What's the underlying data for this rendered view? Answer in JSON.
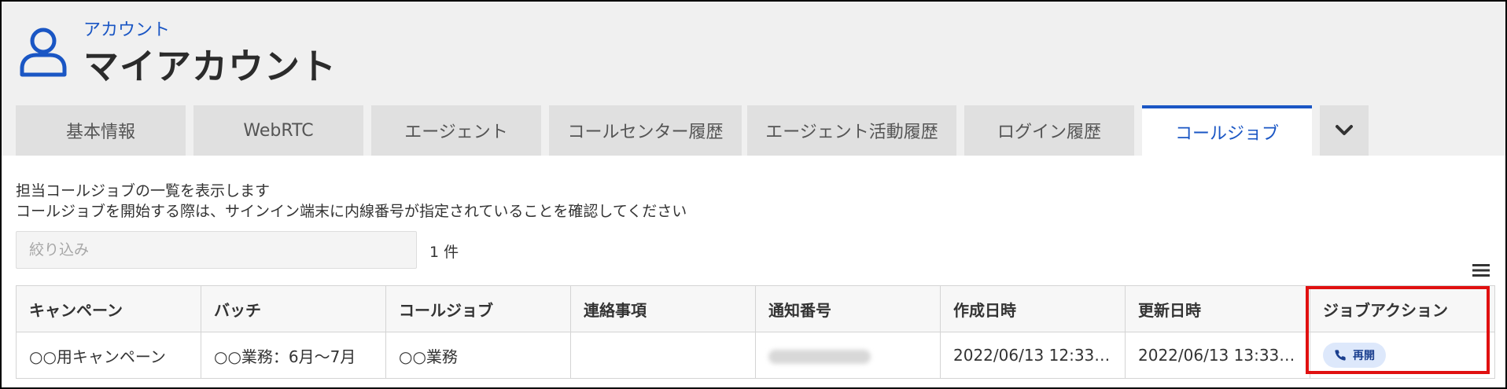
{
  "header": {
    "breadcrumb": "アカウント",
    "title": "マイアカウント"
  },
  "tabs": [
    {
      "label": "基本情報",
      "active": false
    },
    {
      "label": "WebRTC",
      "active": false
    },
    {
      "label": "エージェント",
      "active": false
    },
    {
      "label": "コールセンター履歴",
      "active": false
    },
    {
      "label": "エージェント活動履歴",
      "active": false
    },
    {
      "label": "ログイン履歴",
      "active": false
    },
    {
      "label": "コールジョブ",
      "active": true
    }
  ],
  "more_icon": "chevron-down-icon",
  "description": {
    "line1": "担当コールジョブの一覧を表示します",
    "line2": "コールジョブを開始する際は、サインイン端末に内線番号が指定されていることを確認してください"
  },
  "filter": {
    "placeholder": "絞り込み",
    "value": "",
    "count": "1 件"
  },
  "table": {
    "columns": [
      "キャンペーン",
      "バッチ",
      "コールジョブ",
      "連絡事項",
      "通知番号",
      "作成日時",
      "更新日時",
      "ジョブアクション"
    ],
    "rows": [
      {
        "campaign": "○○用キャンペーン",
        "batch": "○○業務：6月～7月",
        "call_job": "○○業務",
        "notes": "",
        "notify_number": "",
        "created": "2022/06/13 12:33…",
        "updated": "2022/06/13 13:33…",
        "action": {
          "label": "再開",
          "icon": "phone-icon"
        }
      }
    ]
  },
  "colors": {
    "accent": "#1a56c4",
    "highlight": "#e01010",
    "header_bg": "#f0f0f0",
    "tab_bg": "#e0e0e0"
  }
}
